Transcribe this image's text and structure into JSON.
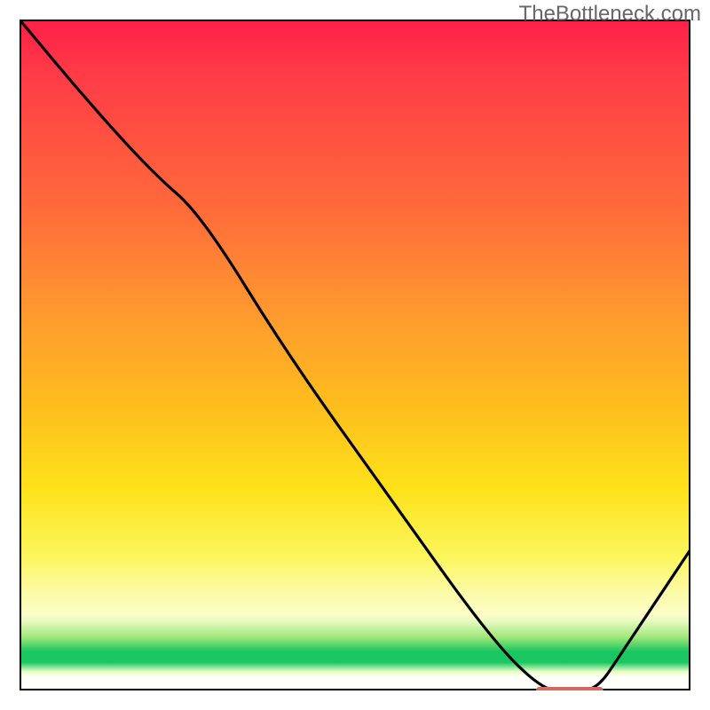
{
  "watermark": "TheBottleneck.com",
  "colors": {
    "frame": "#000000",
    "curve": "#000000",
    "marker": "#d46a5f",
    "watermark_text": "#676767",
    "gradient_top": "#ff1f49",
    "gradient_mid": "#fde21a",
    "gradient_green": "#1ac661"
  },
  "chart_data": {
    "type": "line",
    "title": "",
    "xlabel": "",
    "ylabel": "",
    "xlim": [
      0,
      100
    ],
    "ylim": [
      0,
      100
    ],
    "grid": false,
    "series": [
      {
        "name": "bottleneck-curve",
        "x": [
          0,
          10,
          20,
          27,
          40,
          55,
          70,
          78,
          82,
          86,
          90,
          94,
          100
        ],
        "values": [
          100,
          88,
          77,
          71,
          50,
          29,
          8,
          0,
          0,
          0,
          6,
          12,
          21
        ]
      }
    ],
    "optimum_band": {
      "x_start": 77,
      "x_end": 87,
      "y": 0
    },
    "annotations": []
  }
}
